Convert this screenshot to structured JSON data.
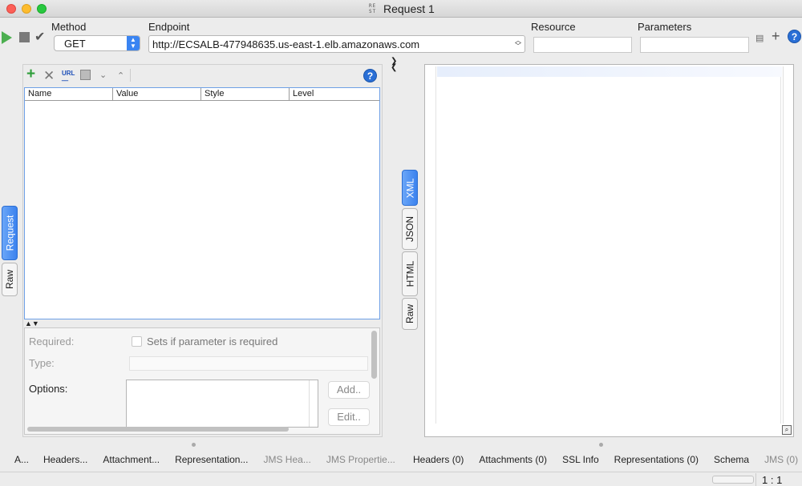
{
  "window": {
    "title": "Request 1",
    "icon_text": "RE ST"
  },
  "toolbar": {
    "method_label": "Method",
    "method_value": "GET",
    "endpoint_label": "Endpoint",
    "endpoint_value": "http://ECSALB-477948635.us-east-1.elb.amazonaws.com",
    "resource_label": "Resource",
    "resource_value": "",
    "parameters_label": "Parameters",
    "parameters_value": ""
  },
  "left_tabs": [
    {
      "label": "Request",
      "active": true
    },
    {
      "label": "Raw",
      "active": false
    }
  ],
  "params_table": {
    "columns": [
      "Name",
      "Value",
      "Style",
      "Level"
    ],
    "rows": []
  },
  "details": {
    "required_label": "Required:",
    "required_checkbox_text": "Sets if parameter is required",
    "type_label": "Type:",
    "options_label": "Options:",
    "add_button": "Add..",
    "edit_button": "Edit.."
  },
  "right_tabs": [
    {
      "label": "XML",
      "active": true
    },
    {
      "label": "JSON",
      "active": false
    },
    {
      "label": "HTML",
      "active": false
    },
    {
      "label": "Raw",
      "active": false
    }
  ],
  "request_bottom_tabs": [
    "A...",
    "Headers...",
    "Attachment...",
    "Representation...",
    "JMS Hea...",
    "JMS Propertie..."
  ],
  "response_bottom_tabs": [
    "Headers (0)",
    "Attachments (0)",
    "SSL Info",
    "Representations (0)",
    "Schema",
    "JMS (0)"
  ],
  "status": {
    "ratio": "1 : 1"
  },
  "colors": {
    "accent": "#3b82ee",
    "play": "#4caf50",
    "help": "#2a6fd6"
  },
  "icons": [
    "play-icon",
    "stop-icon",
    "check-icon",
    "add-icon",
    "delete-icon",
    "url-icon",
    "copy-icon",
    "move-down-icon",
    "move-up-icon",
    "help-icon",
    "search-icon"
  ]
}
